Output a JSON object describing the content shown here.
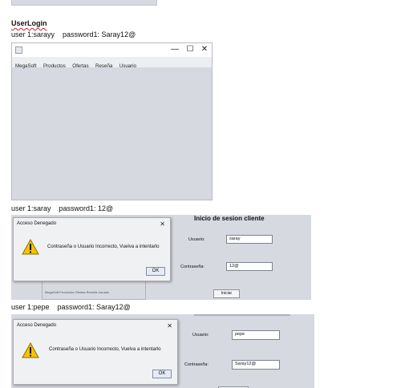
{
  "doc": {
    "heading": "UserLogin",
    "case1": "user 1:sarayy    password1: Saray12@",
    "case2": "user 1:saray    password1: 12@",
    "case3": "user 1:pepe    password1: Saray12@"
  },
  "main_window": {
    "min_glyph": "—",
    "max_glyph": "☐",
    "close_glyph": "✕",
    "menu": [
      "MegaSoft",
      "Productos",
      "Ofertas",
      "Reseña",
      "Usuario"
    ]
  },
  "shot2": {
    "login_title": "Inicio de sesion cliente",
    "usuario_label": "Usuario:",
    "usuario_value": "saray",
    "contrasena_label": "Contraseña:",
    "contrasena_value": "12@",
    "iniciar_label": "Iniciar",
    "mini_menu": "MegaSoft  Productos  Ofertas  Reseña  Usuario",
    "dialog": {
      "title": "Acceso Denegado",
      "close": "✕",
      "message": "Contraseña o Usuario Incorrecto, Vuelva a intentarlo",
      "ok": "OK"
    }
  },
  "shot3": {
    "usuario_label": "Usuario:",
    "usuario_value": "pepe",
    "contrasena_label": "Contraseña:",
    "contrasena_value": "Saray12@",
    "dialog": {
      "title": "Acceso Denegado",
      "close": "✕",
      "message": "Contraseña o Usuario Incorrecto, Vuelva a intentarlo",
      "ok": "OK"
    }
  },
  "colors": {
    "swing_background": "#d6d9df",
    "warning_yellow": "#f5c400"
  },
  "icons": [
    "app-icon",
    "warning-icon",
    "close-icon"
  ]
}
